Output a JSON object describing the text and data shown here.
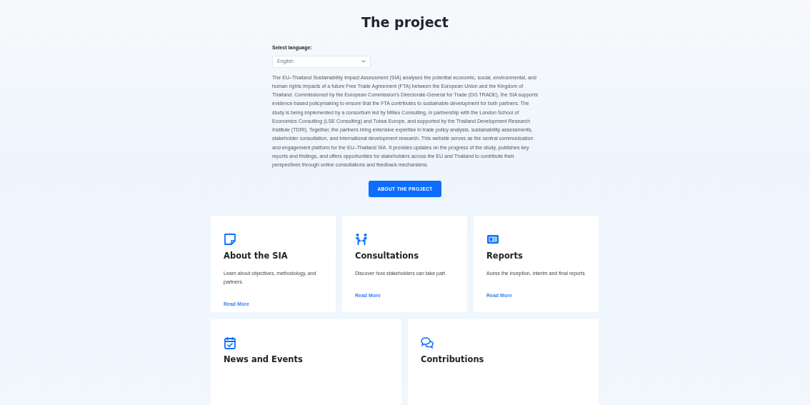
{
  "title": "The project",
  "language": {
    "label": "Select language:",
    "value": "English"
  },
  "description": "The EU–Thailand Sustainability Impact Assessment (SIA) analyses the potential economic, social, environmental, and human rights impacts of a future Free Trade Agreement (FTA) between the European Union and the Kingdom of Thailand. Commissioned by the European Commission’s Directorate-General for Trade (DG TRADE), the SIA supports evidence-based policymaking to ensure that the FTA contributes to sustainable development for both partners. The study is being implemented by a consortium led by Milieu Consulting, in partnership with the London School of Economics Consulting (LSE Consulting) and Tutwa Europe, and supported by the Thailand Development Research Institute (TDRI). Together, the partners bring extensive expertise in trade policy analysis, sustainability assessments, stakeholder consultation, and international development research. This website serves as the central communication and engagement platform for the EU–Thailand SIA. It provides updates on the progress of the study, publishes key reports and findings, and offers opportunities for stakeholders across the EU and Thailand to contribute their perspectives through online consultations and feedback mechanisms.",
  "button": "ABOUT THE PROJECT",
  "cards": [
    {
      "title": "About the SIA",
      "text": "Learn about objectives, methodology, and partners.",
      "link": "Read More"
    },
    {
      "title": "Consultations",
      "text": "Discover how stakeholders can take part.",
      "link": "Read More"
    },
    {
      "title": "Reports",
      "text": "Acess the inception, interim and final reports",
      "link": "Read More"
    },
    {
      "title": "News and Events"
    },
    {
      "title": "Contributions"
    }
  ]
}
